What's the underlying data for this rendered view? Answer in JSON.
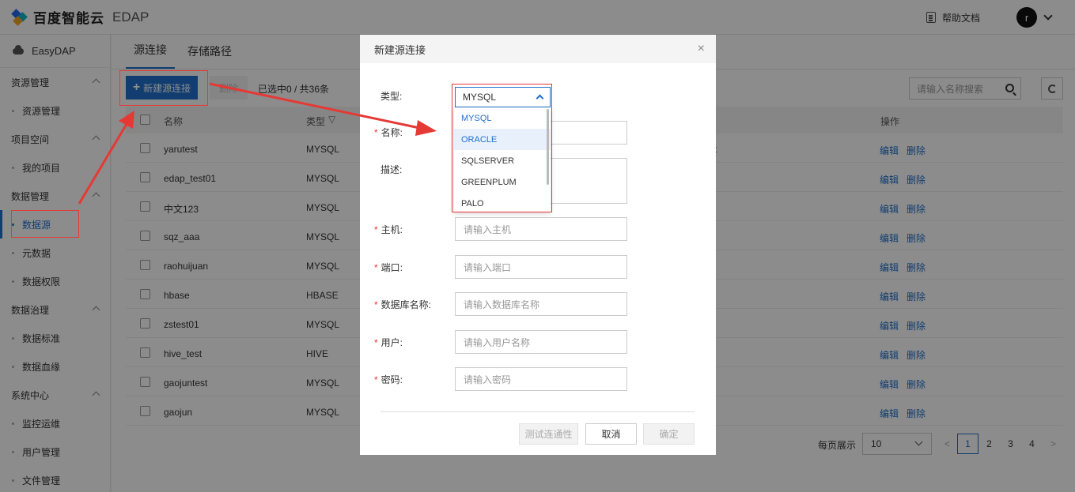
{
  "brand": {
    "name": "百度智能云",
    "product": "EDAP"
  },
  "topbar": {
    "help_label": "帮助文档",
    "avatar_letter": "r"
  },
  "sidebar": {
    "head": "EasyDAP",
    "groups": [
      {
        "label": "资源管理",
        "items": [
          "资源管理"
        ]
      },
      {
        "label": "项目空间",
        "items": [
          "我的项目"
        ]
      },
      {
        "label": "数据管理",
        "items": [
          "数据源",
          "元数据",
          "数据权限"
        ]
      },
      {
        "label": "数据治理",
        "items": [
          "数据标准",
          "数据血缘"
        ]
      },
      {
        "label": "系统中心",
        "items": [
          "监控运维",
          "用户管理",
          "文件管理"
        ]
      }
    ],
    "active_item": "数据源"
  },
  "main": {
    "tabs": [
      "源连接",
      "存储路径"
    ],
    "new_button": "新建源连接",
    "delete_button": "删除",
    "selection_info": "已选中0 / 共36条",
    "search_placeholder": "请输入名称搜索",
    "columns": {
      "name": "名称",
      "type": "类型",
      "ops": "操作"
    },
    "partial_cell": "t",
    "rows": [
      {
        "name": "yarutest",
        "type": "MYSQL"
      },
      {
        "name": "edap_test01",
        "type": "MYSQL"
      },
      {
        "name": "中文123",
        "type": "MYSQL"
      },
      {
        "name": "sqz_aaa",
        "type": "MYSQL"
      },
      {
        "name": "raohuijuan",
        "type": "MYSQL"
      },
      {
        "name": "hbase",
        "type": "HBASE"
      },
      {
        "name": "zstest01",
        "type": "MYSQL"
      },
      {
        "name": "hive_test",
        "type": "HIVE"
      },
      {
        "name": "gaojuntest",
        "type": "MYSQL"
      },
      {
        "name": "gaojun",
        "type": "MYSQL"
      }
    ],
    "edit_label": "编辑",
    "remove_label": "删除",
    "pagination": {
      "page_size_label": "每页展示",
      "page_size": "10",
      "prev": "<",
      "next": ">",
      "pages": [
        "1",
        "2",
        "3",
        "4"
      ],
      "current": "1"
    }
  },
  "modal": {
    "title": "新建源连接",
    "close": "×",
    "fields": {
      "type": {
        "label": "类型:",
        "value": "MYSQL"
      },
      "name": {
        "label": "名称:"
      },
      "desc": {
        "label": "描述:"
      },
      "host": {
        "label": "主机:",
        "placeholder": "请输入主机"
      },
      "port": {
        "label": "端口:",
        "placeholder": "请输入端口"
      },
      "dbname": {
        "label": "数据库名称:",
        "placeholder": "请输入数据库名称"
      },
      "user": {
        "label": "用户:",
        "placeholder": "请输入用户名称"
      },
      "password": {
        "label": "密码:",
        "placeholder": "请输入密码"
      }
    },
    "required_mark": "*",
    "type_options": [
      "MYSQL",
      "ORACLE",
      "SQLSERVER",
      "GREENPLUM",
      "PALO"
    ],
    "buttons": {
      "test": "测试连通性",
      "cancel": "取消",
      "ok": "确定"
    }
  },
  "colors": {
    "accent": "#1f6fcc",
    "annotation": "#e53935"
  }
}
